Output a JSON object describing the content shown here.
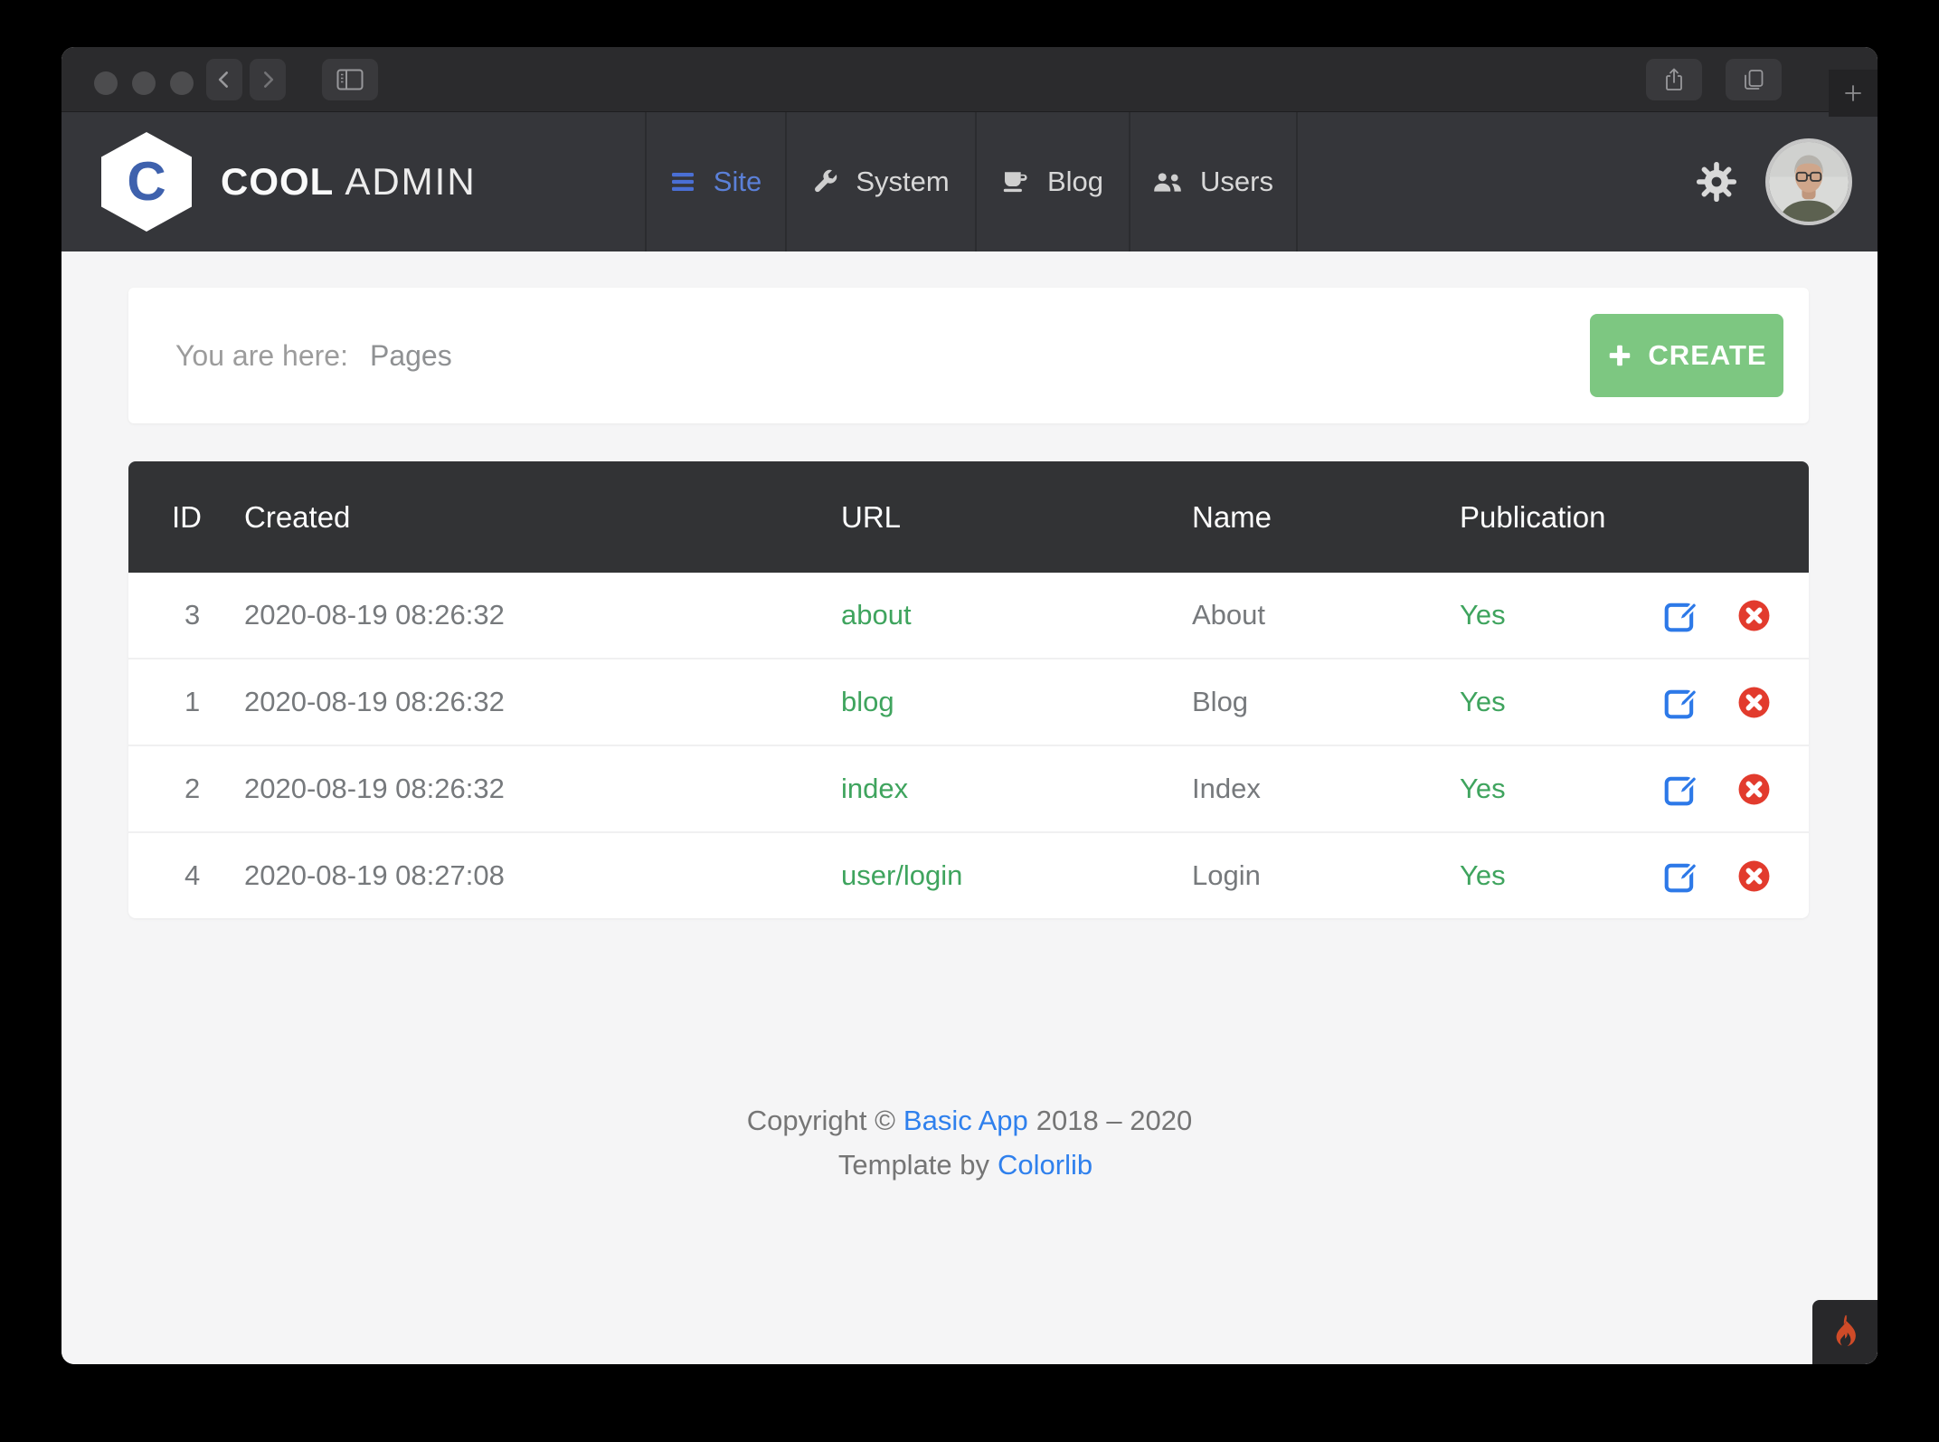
{
  "brand": {
    "initial": "C",
    "name_bold": "COOL",
    "name_light": "ADMIN"
  },
  "nav": {
    "items": [
      {
        "label": "Site",
        "icon": "menu-bars-icon",
        "active": true
      },
      {
        "label": "System",
        "icon": "wrench-icon",
        "active": false
      },
      {
        "label": "Blog",
        "icon": "coffee-cup-icon",
        "active": false
      },
      {
        "label": "Users",
        "icon": "users-icon",
        "active": false
      }
    ]
  },
  "breadcrumb": {
    "prefix": "You are here:",
    "current": "Pages"
  },
  "create_button": {
    "label": "CREATE",
    "icon": "plus-icon"
  },
  "table": {
    "columns": [
      "ID",
      "Created",
      "URL",
      "Name",
      "Publication"
    ],
    "rows": [
      {
        "id": "3",
        "created": "2020-08-19 08:26:32",
        "url": "about",
        "name": "About",
        "publication": "Yes"
      },
      {
        "id": "1",
        "created": "2020-08-19 08:26:32",
        "url": "blog",
        "name": "Blog",
        "publication": "Yes"
      },
      {
        "id": "2",
        "created": "2020-08-19 08:26:32",
        "url": "index",
        "name": "Index",
        "publication": "Yes"
      },
      {
        "id": "4",
        "created": "2020-08-19 08:27:08",
        "url": "user/login",
        "name": "Login",
        "publication": "Yes"
      }
    ]
  },
  "footer": {
    "line1_prefix": "Copyright ©",
    "line1_link": "Basic App",
    "line1_suffix": "2018 – 2020",
    "line2_prefix": "Template by",
    "line2_link": "Colorlib"
  },
  "colors": {
    "accent_green": "#7dc781",
    "link_green": "#3fa45e",
    "link_blue": "#2f80ed",
    "edit_blue": "#2d79e8",
    "delete_red": "#e23b2d",
    "flame_orange": "#cf4b28",
    "nav_active_blue": "#5b80d8",
    "navbar_dark": "#35363a",
    "table_header_dark": "#323335"
  }
}
